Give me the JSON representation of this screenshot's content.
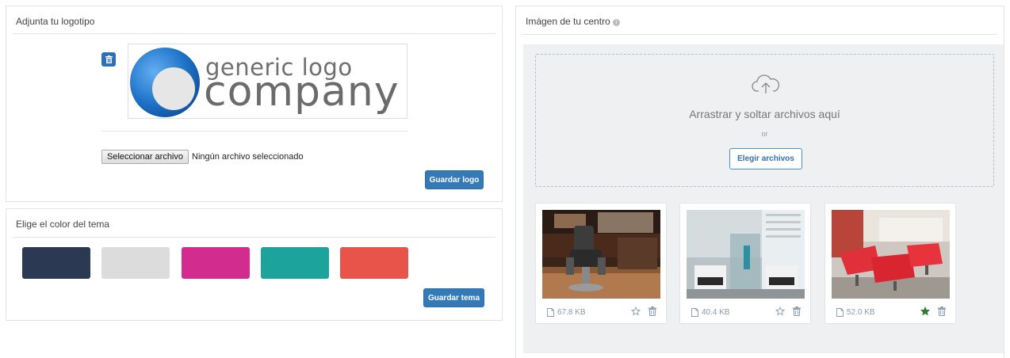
{
  "logo_panel": {
    "title": "Adjunta tu logotipo",
    "logo": {
      "line1": "generic logo",
      "line2": "company",
      "brand_color": "#1f73c8"
    },
    "file_button_label": "Seleccionar archivo",
    "file_status": "Ningún archivo seleccionado",
    "save_label": "Guardar logo"
  },
  "theme_panel": {
    "title": "Elige el color del tema",
    "swatches": [
      {
        "color": "#2b3a52"
      },
      {
        "color": "#dcdcdc"
      },
      {
        "color": "#d22c8f"
      },
      {
        "color": "#1ba39c"
      },
      {
        "color": "#e8534a"
      }
    ],
    "save_label": "Guardar tema"
  },
  "image_panel": {
    "title": "Imágen de tu centro",
    "dropzone": {
      "text": "Arrastrar y soltar archivos aquí",
      "or": "or",
      "button_label": "Elegir archivos"
    },
    "images": [
      {
        "size": "67.8 KB",
        "favorite": false,
        "icon": "barber-chair-photo"
      },
      {
        "size": "40.4 KB",
        "favorite": false,
        "icon": "salon-room-photo"
      },
      {
        "size": "52.0 KB",
        "favorite": true,
        "icon": "red-chairs-photo"
      }
    ],
    "colors": {
      "accent": "#337ab7",
      "favorite_star": "#2e7d32"
    }
  }
}
